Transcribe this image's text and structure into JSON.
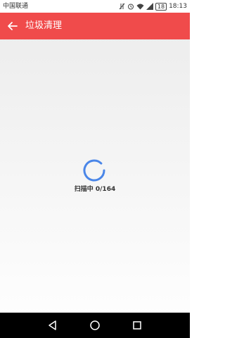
{
  "status_bar": {
    "carrier": "中国联通",
    "battery": "18",
    "time": "18:13"
  },
  "header": {
    "title": "垃圾清理",
    "back_icon": "arrow-left-icon",
    "background": "#f04b4b"
  },
  "main": {
    "scan_status": "扫描中 0/164",
    "spinner_color": "#4a86e8"
  },
  "nav_bar": {
    "back_icon": "triangle-back-icon",
    "home_icon": "circle-home-icon",
    "recents_icon": "square-recents-icon"
  }
}
